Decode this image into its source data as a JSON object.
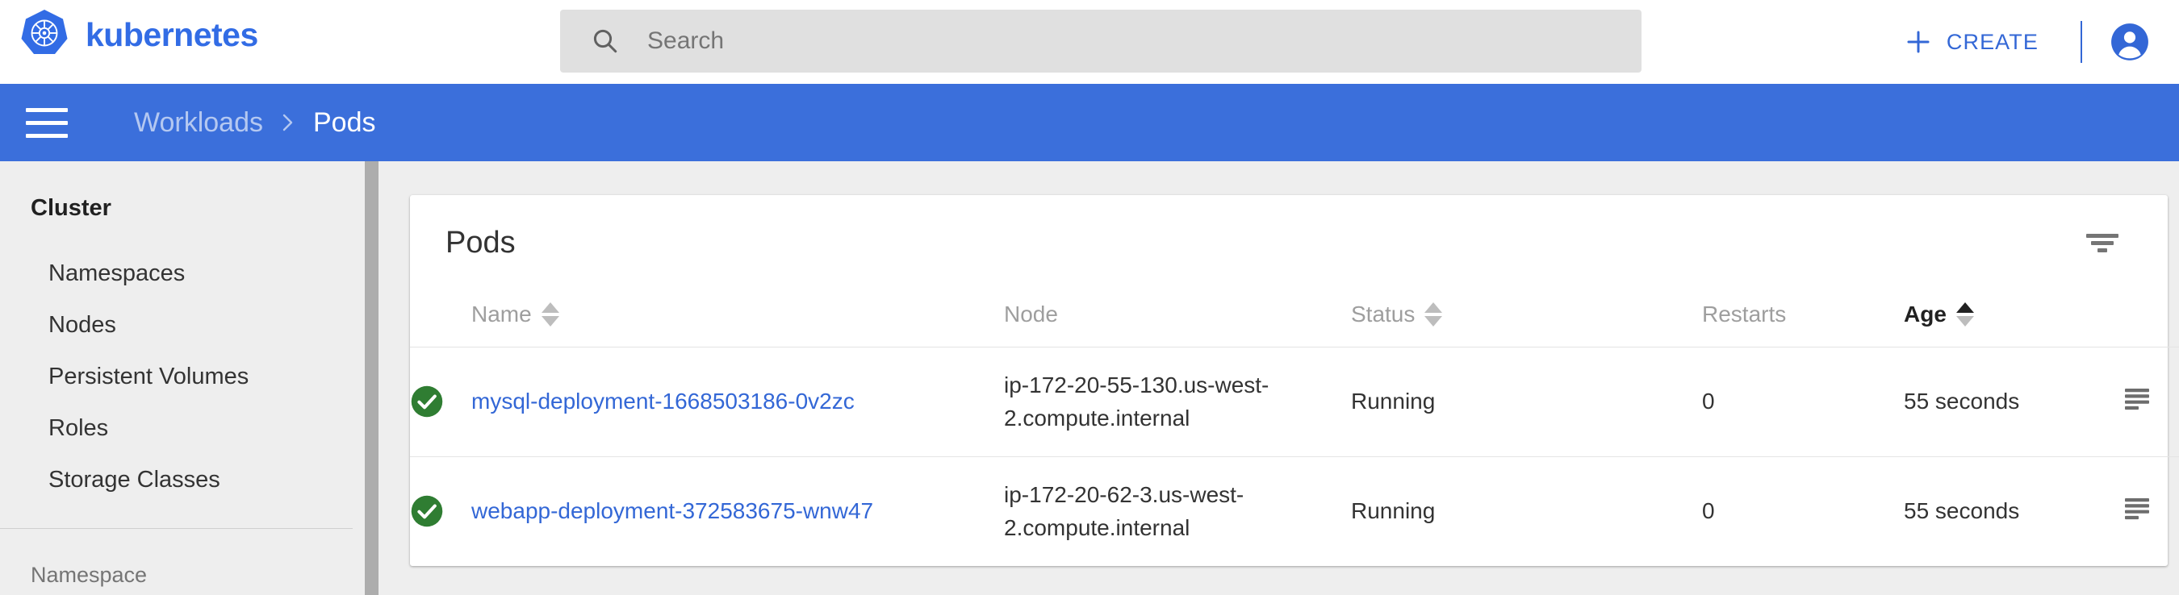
{
  "topbar": {
    "brand_name": "kubernetes",
    "logo_icon": "kubernetes-logo",
    "search": {
      "icon": "search-icon",
      "placeholder": "Search",
      "value": ""
    },
    "create_button": {
      "icon": "plus-icon",
      "label": "CREATE"
    },
    "account_icon": "account-circle-icon"
  },
  "breadcrumb_bar": {
    "menu_icon": "hamburger-menu-icon",
    "parent": "Workloads",
    "separator_icon": "chevron-right-icon",
    "current": "Pods"
  },
  "sidebar": {
    "section_title": "Cluster",
    "items": [
      {
        "label": "Namespaces"
      },
      {
        "label": "Nodes"
      },
      {
        "label": "Persistent Volumes"
      },
      {
        "label": "Roles"
      },
      {
        "label": "Storage Classes"
      }
    ],
    "namespace_label": "Namespace"
  },
  "card": {
    "title": "Pods",
    "filter_icon": "filter-icon",
    "columns": [
      {
        "key": "name",
        "label": "Name",
        "sortable": true,
        "active": false
      },
      {
        "key": "node",
        "label": "Node",
        "sortable": false,
        "active": false
      },
      {
        "key": "status",
        "label": "Status",
        "sortable": true,
        "active": false
      },
      {
        "key": "restarts",
        "label": "Restarts",
        "sortable": false,
        "active": false
      },
      {
        "key": "age",
        "label": "Age",
        "sortable": true,
        "active": true
      }
    ],
    "rows": [
      {
        "status_icon": "check-circle-icon",
        "name": "mysql-deployment-1668503186-0v2zc",
        "node": "ip-172-20-55-130.us-west-2.compute.internal",
        "status": "Running",
        "restarts": "0",
        "age": "55 seconds",
        "logs_icon": "logs-icon",
        "menu_icon": "more-vert-icon"
      },
      {
        "status_icon": "check-circle-icon",
        "name": "webapp-deployment-372583675-wnw47",
        "node": "ip-172-20-62-3.us-west-2.compute.internal",
        "status": "Running",
        "restarts": "0",
        "age": "55 seconds",
        "logs_icon": "logs-icon",
        "menu_icon": "more-vert-icon"
      }
    ]
  },
  "colors": {
    "brand_blue": "#326ce5",
    "bar_blue": "#3b6fdb",
    "link_blue": "#3367d6",
    "status_green": "#2f7d32",
    "sidebar_bg": "#eeeeee",
    "search_bg": "#e0e0e0"
  }
}
